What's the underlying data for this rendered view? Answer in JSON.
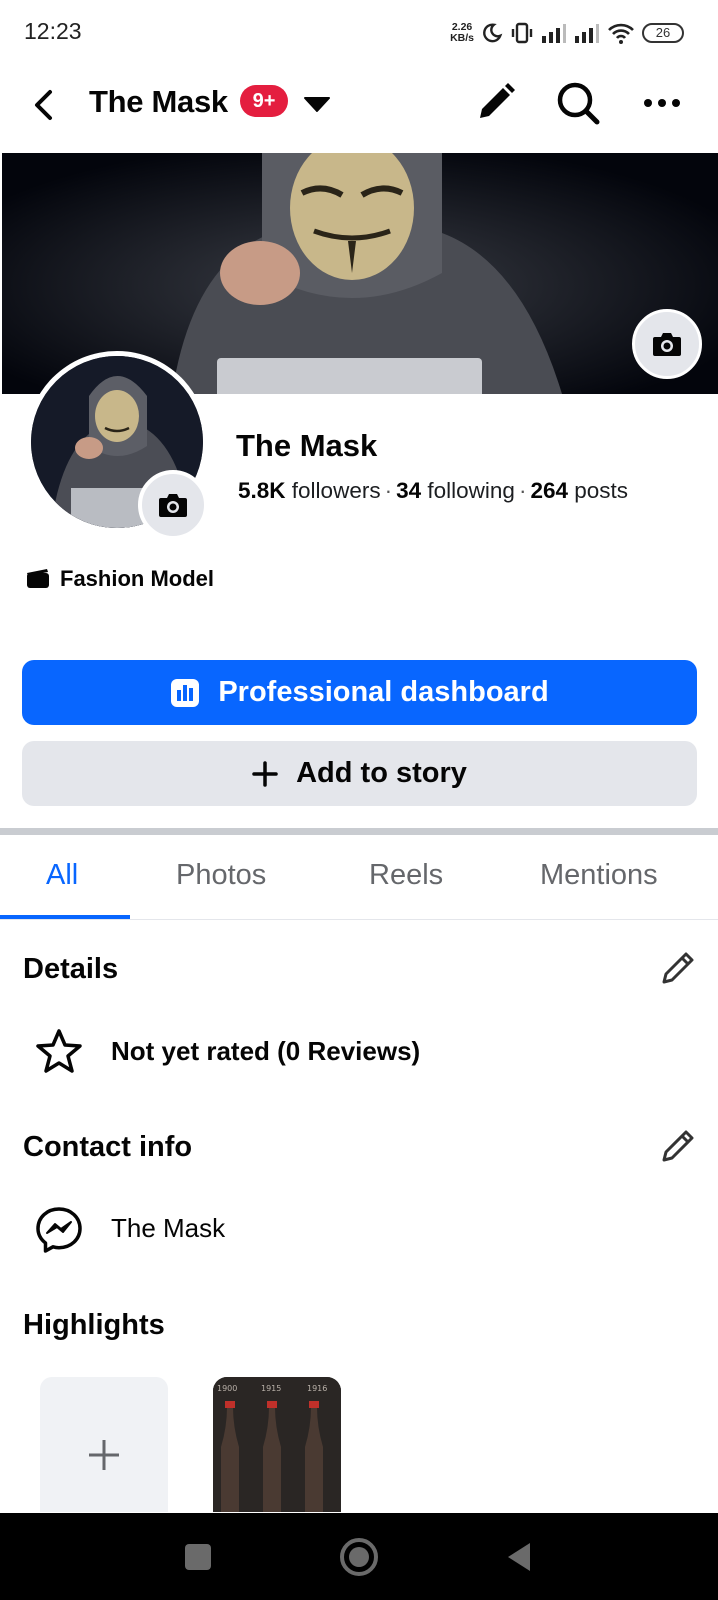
{
  "status_bar": {
    "time": "12:23",
    "speed_value": "2.26",
    "speed_unit": "KB/s",
    "battery": "26",
    "icons": [
      "moon-icon",
      "vibrate-icon",
      "signal-icon",
      "signal-icon",
      "wifi-icon",
      "battery-icon"
    ]
  },
  "appbar": {
    "title": "The Mask",
    "badge": "9+",
    "icons": [
      "back-arrow-icon",
      "caret-down-icon",
      "pencil-icon",
      "search-icon",
      "more-icon"
    ]
  },
  "profile": {
    "name": "The Mask",
    "followers_count": "5.8K",
    "followers_label": "followers",
    "following_count": "34",
    "following_label": "following",
    "posts_count": "264",
    "posts_label": "posts",
    "category": "Fashion Model"
  },
  "buttons": {
    "dashboard": "Professional dashboard",
    "story": "Add to story"
  },
  "tabs": [
    {
      "label": "All",
      "active": true
    },
    {
      "label": "Photos",
      "active": false
    },
    {
      "label": "Reels",
      "active": false
    },
    {
      "label": "Mentions",
      "active": false
    }
  ],
  "details": {
    "title": "Details",
    "rating": "Not yet rated (0 Reviews)"
  },
  "contact": {
    "title": "Contact info",
    "messenger": "The Mask"
  },
  "highlights": {
    "title": "Highlights",
    "photo_labels": [
      "1900",
      "1915",
      "1916"
    ]
  },
  "colors": {
    "accent": "#0866ff",
    "badge": "#e41e3f",
    "secondary_button": "#e4e6eb"
  }
}
